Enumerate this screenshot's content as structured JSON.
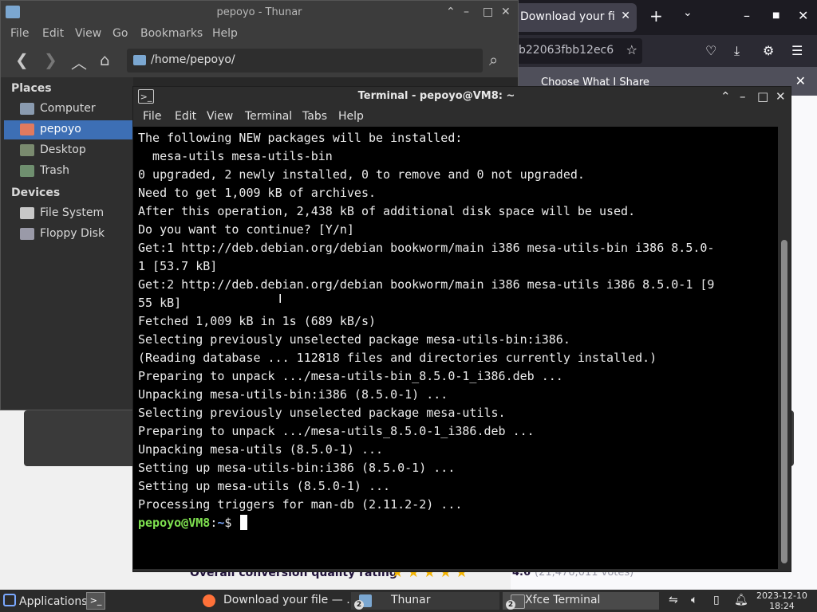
{
  "firefox": {
    "tab_title": "Download your file",
    "tab_close": "✕",
    "new_tab": "+",
    "tab_list": "⌄",
    "url_fragment": "b22063fbb12ec6",
    "notification": "Choose What I Share",
    "rating_label": "Overall conversion quality rating",
    "rating_stars": "★★★★★",
    "rating_score": "4.6",
    "rating_votes": "(21,476,011 votes)"
  },
  "thunar": {
    "title": "pepoyo - Thunar",
    "menu": [
      "File",
      "Edit",
      "View",
      "Go",
      "Bookmarks",
      "Help"
    ],
    "path": "/home/pepoyo/",
    "places_header": "Places",
    "places": [
      "Computer",
      "pepoyo",
      "Desktop",
      "Trash"
    ],
    "devices_header": "Devices",
    "devices": [
      "File System",
      "Floppy Disk"
    ]
  },
  "terminal": {
    "title": "Terminal - pepoyo@VM8: ~",
    "menu": [
      "File",
      "Edit",
      "View",
      "Terminal",
      "Tabs",
      "Help"
    ],
    "lines": [
      "The following NEW packages will be installed:",
      "  mesa-utils mesa-utils-bin",
      "0 upgraded, 2 newly installed, 0 to remove and 0 not upgraded.",
      "Need to get 1,009 kB of archives.",
      "After this operation, 2,438 kB of additional disk space will be used.",
      "Do you want to continue? [Y/n]",
      "Get:1 http://deb.debian.org/debian bookworm/main i386 mesa-utils-bin i386 8.5.0-",
      "1 [53.7 kB]",
      "Get:2 http://deb.debian.org/debian bookworm/main i386 mesa-utils i386 8.5.0-1 [9",
      "55 kB]",
      "Fetched 1,009 kB in 1s (689 kB/s)",
      "Selecting previously unselected package mesa-utils-bin:i386.",
      "(Reading database ... 112818 files and directories currently installed.)",
      "Preparing to unpack .../mesa-utils-bin_8.5.0-1_i386.deb ...",
      "Unpacking mesa-utils-bin:i386 (8.5.0-1) ...",
      "Selecting previously unselected package mesa-utils.",
      "Preparing to unpack .../mesa-utils_8.5.0-1_i386.deb ...",
      "Unpacking mesa-utils (8.5.0-1) ...",
      "Setting up mesa-utils-bin:i386 (8.5.0-1) ...",
      "Setting up mesa-utils (8.5.0-1) ...",
      "Processing triggers for man-db (2.11.2-2) ..."
    ],
    "prompt_user": "pepoyo@VM8",
    "prompt_sep": ":",
    "prompt_path": "~",
    "prompt_sign": "$ "
  },
  "taskbar": {
    "applications": "Applications",
    "tasks": [
      {
        "label": "Download your file — ...",
        "badge": ""
      },
      {
        "label": "Thunar",
        "badge": "2"
      },
      {
        "label": "Xfce Terminal",
        "badge": "2"
      }
    ],
    "date": "2023-12-10",
    "time": "18:24"
  },
  "colors": {
    "prompt_user": "#7ee04f",
    "selection": "#3d6fb5",
    "terminal_bg": "#000000"
  }
}
